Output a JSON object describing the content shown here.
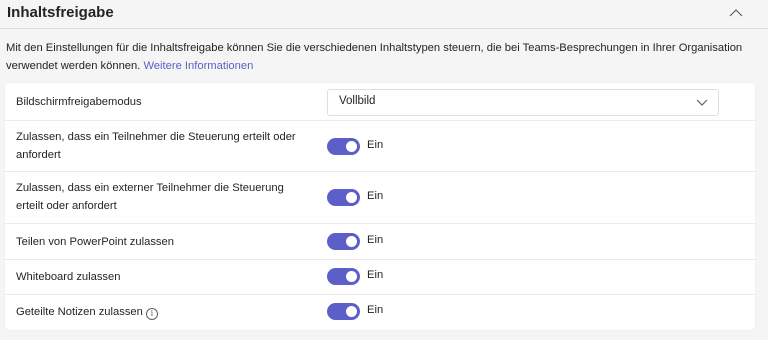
{
  "section": {
    "title": "Inhaltsfreigabe",
    "collapse_icon": "chevron-up-icon",
    "description": "Mit den Einstellungen für die Inhaltsfreigabe können Sie die verschiedenen Inhaltstypen steuern, die bei Teams-Besprechungen in Ihrer Organisation verwendet werden können.",
    "link_text": "Weitere Informationen"
  },
  "settings": {
    "screen_sharing": {
      "label": "Bildschirmfreigabemodus",
      "value": "Vollbild"
    },
    "participant_control": {
      "label": "Zulassen, dass ein Teilnehmer die Steuerung erteilt oder anfordert",
      "state": "Ein"
    },
    "external_control": {
      "label": "Zulassen, dass ein externer Teilnehmer die Steuerung erteilt oder anfordert",
      "state": "Ein"
    },
    "powerpoint": {
      "label": "Teilen von PowerPoint zulassen",
      "state": "Ein"
    },
    "whiteboard": {
      "label": "Whiteboard zulassen",
      "state": "Ein"
    },
    "shared_notes": {
      "label": "Geteilte Notizen zulassen",
      "info_icon": "info-icon",
      "state": "Ein"
    }
  },
  "colors": {
    "accent": "#5b5fc7",
    "text": "#252423",
    "background": "#f5f5f5",
    "card": "#ffffff"
  }
}
